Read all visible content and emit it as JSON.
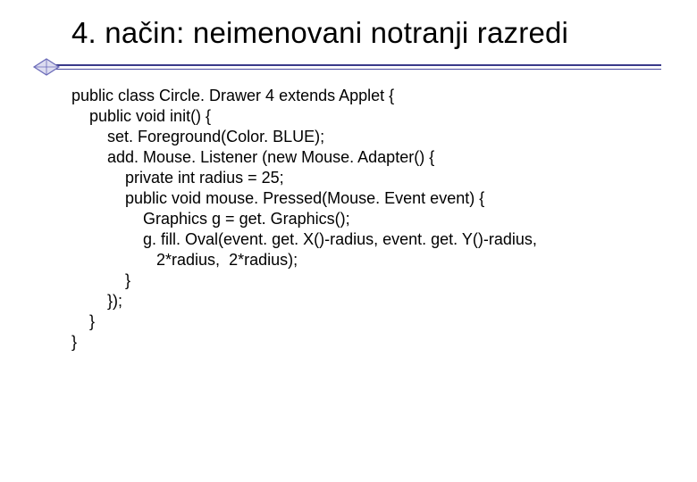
{
  "title": "4. način: neimenovani notranji razredi",
  "code": "public class Circle. Drawer 4 extends Applet {\n    public void init() {\n        set. Foreground(Color. BLUE);\n        add. Mouse. Listener (new Mouse. Adapter() {\n            private int radius = 25;\n            public void mouse. Pressed(Mouse. Event event) {\n                Graphics g = get. Graphics();\n                g. fill. Oval(event. get. X()-radius, event. get. Y()-radius,\n                   2*radius,  2*radius);\n            }\n        });\n    }\n}"
}
